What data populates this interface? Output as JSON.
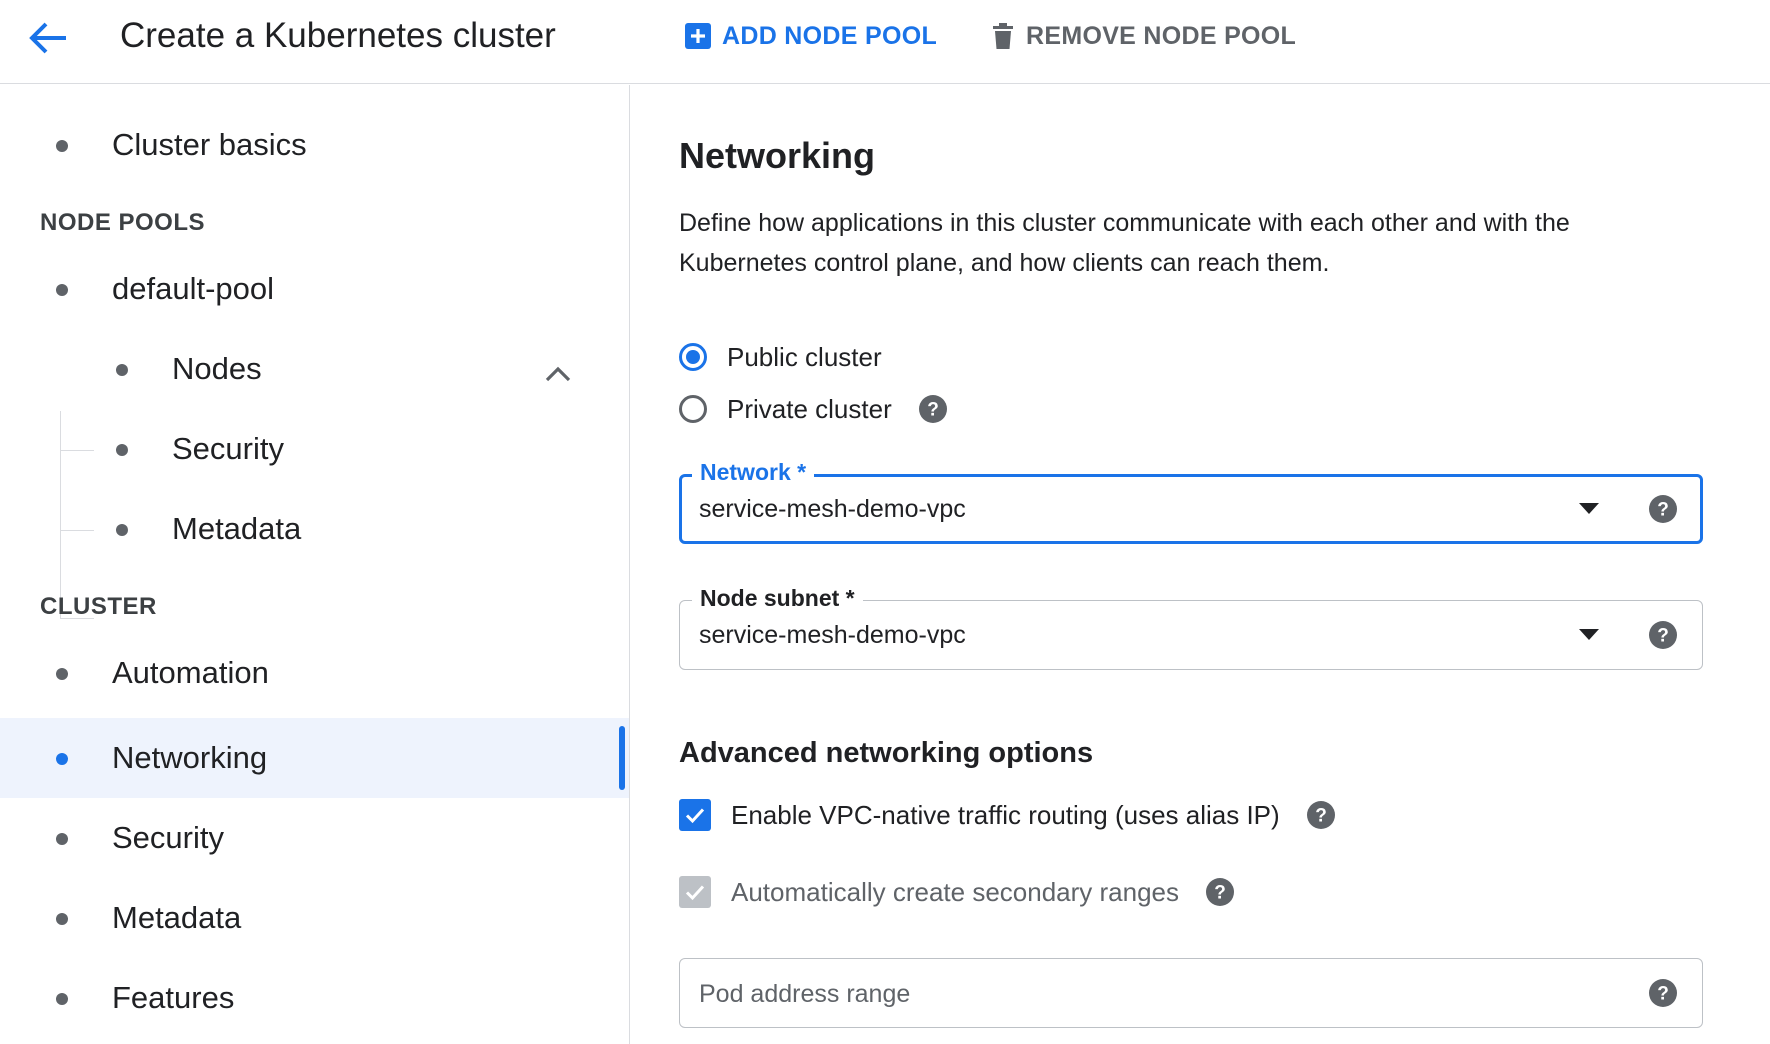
{
  "header": {
    "title": "Create a Kubernetes cluster",
    "add_node_pool": "ADD NODE POOL",
    "remove_node_pool": "REMOVE NODE POOL"
  },
  "sidebar": {
    "cluster_basics": "Cluster basics",
    "node_pools_heading": "NODE POOLS",
    "default_pool": "default-pool",
    "pool_children": [
      "Nodes",
      "Security",
      "Metadata"
    ],
    "cluster_heading": "CLUSTER",
    "cluster_items": [
      "Automation",
      "Networking",
      "Security",
      "Metadata",
      "Features"
    ],
    "active_item": "Networking"
  },
  "main": {
    "title": "Networking",
    "description": "Define how applications in this cluster communicate with each other and with the Kubernetes control plane, and how clients can reach them.",
    "radio_public": "Public cluster",
    "radio_private": "Private cluster",
    "selected_radio": "Public cluster",
    "network_field": {
      "label": "Network *",
      "value": "service-mesh-demo-vpc"
    },
    "subnet_field": {
      "label": "Node subnet *",
      "value": "service-mesh-demo-vpc"
    },
    "advanced_title": "Advanced networking options",
    "vpc_native": {
      "label": "Enable VPC-native traffic routing (uses alias IP)",
      "checked": true
    },
    "secondary_ranges": {
      "label": "Automatically create secondary ranges",
      "checked": true,
      "disabled": true
    },
    "pod_range_placeholder": "Pod address range"
  },
  "colors": {
    "accent": "#1a73e8",
    "active_bg": "#eef3fd",
    "text": "#202124",
    "muted": "#5f6368"
  }
}
